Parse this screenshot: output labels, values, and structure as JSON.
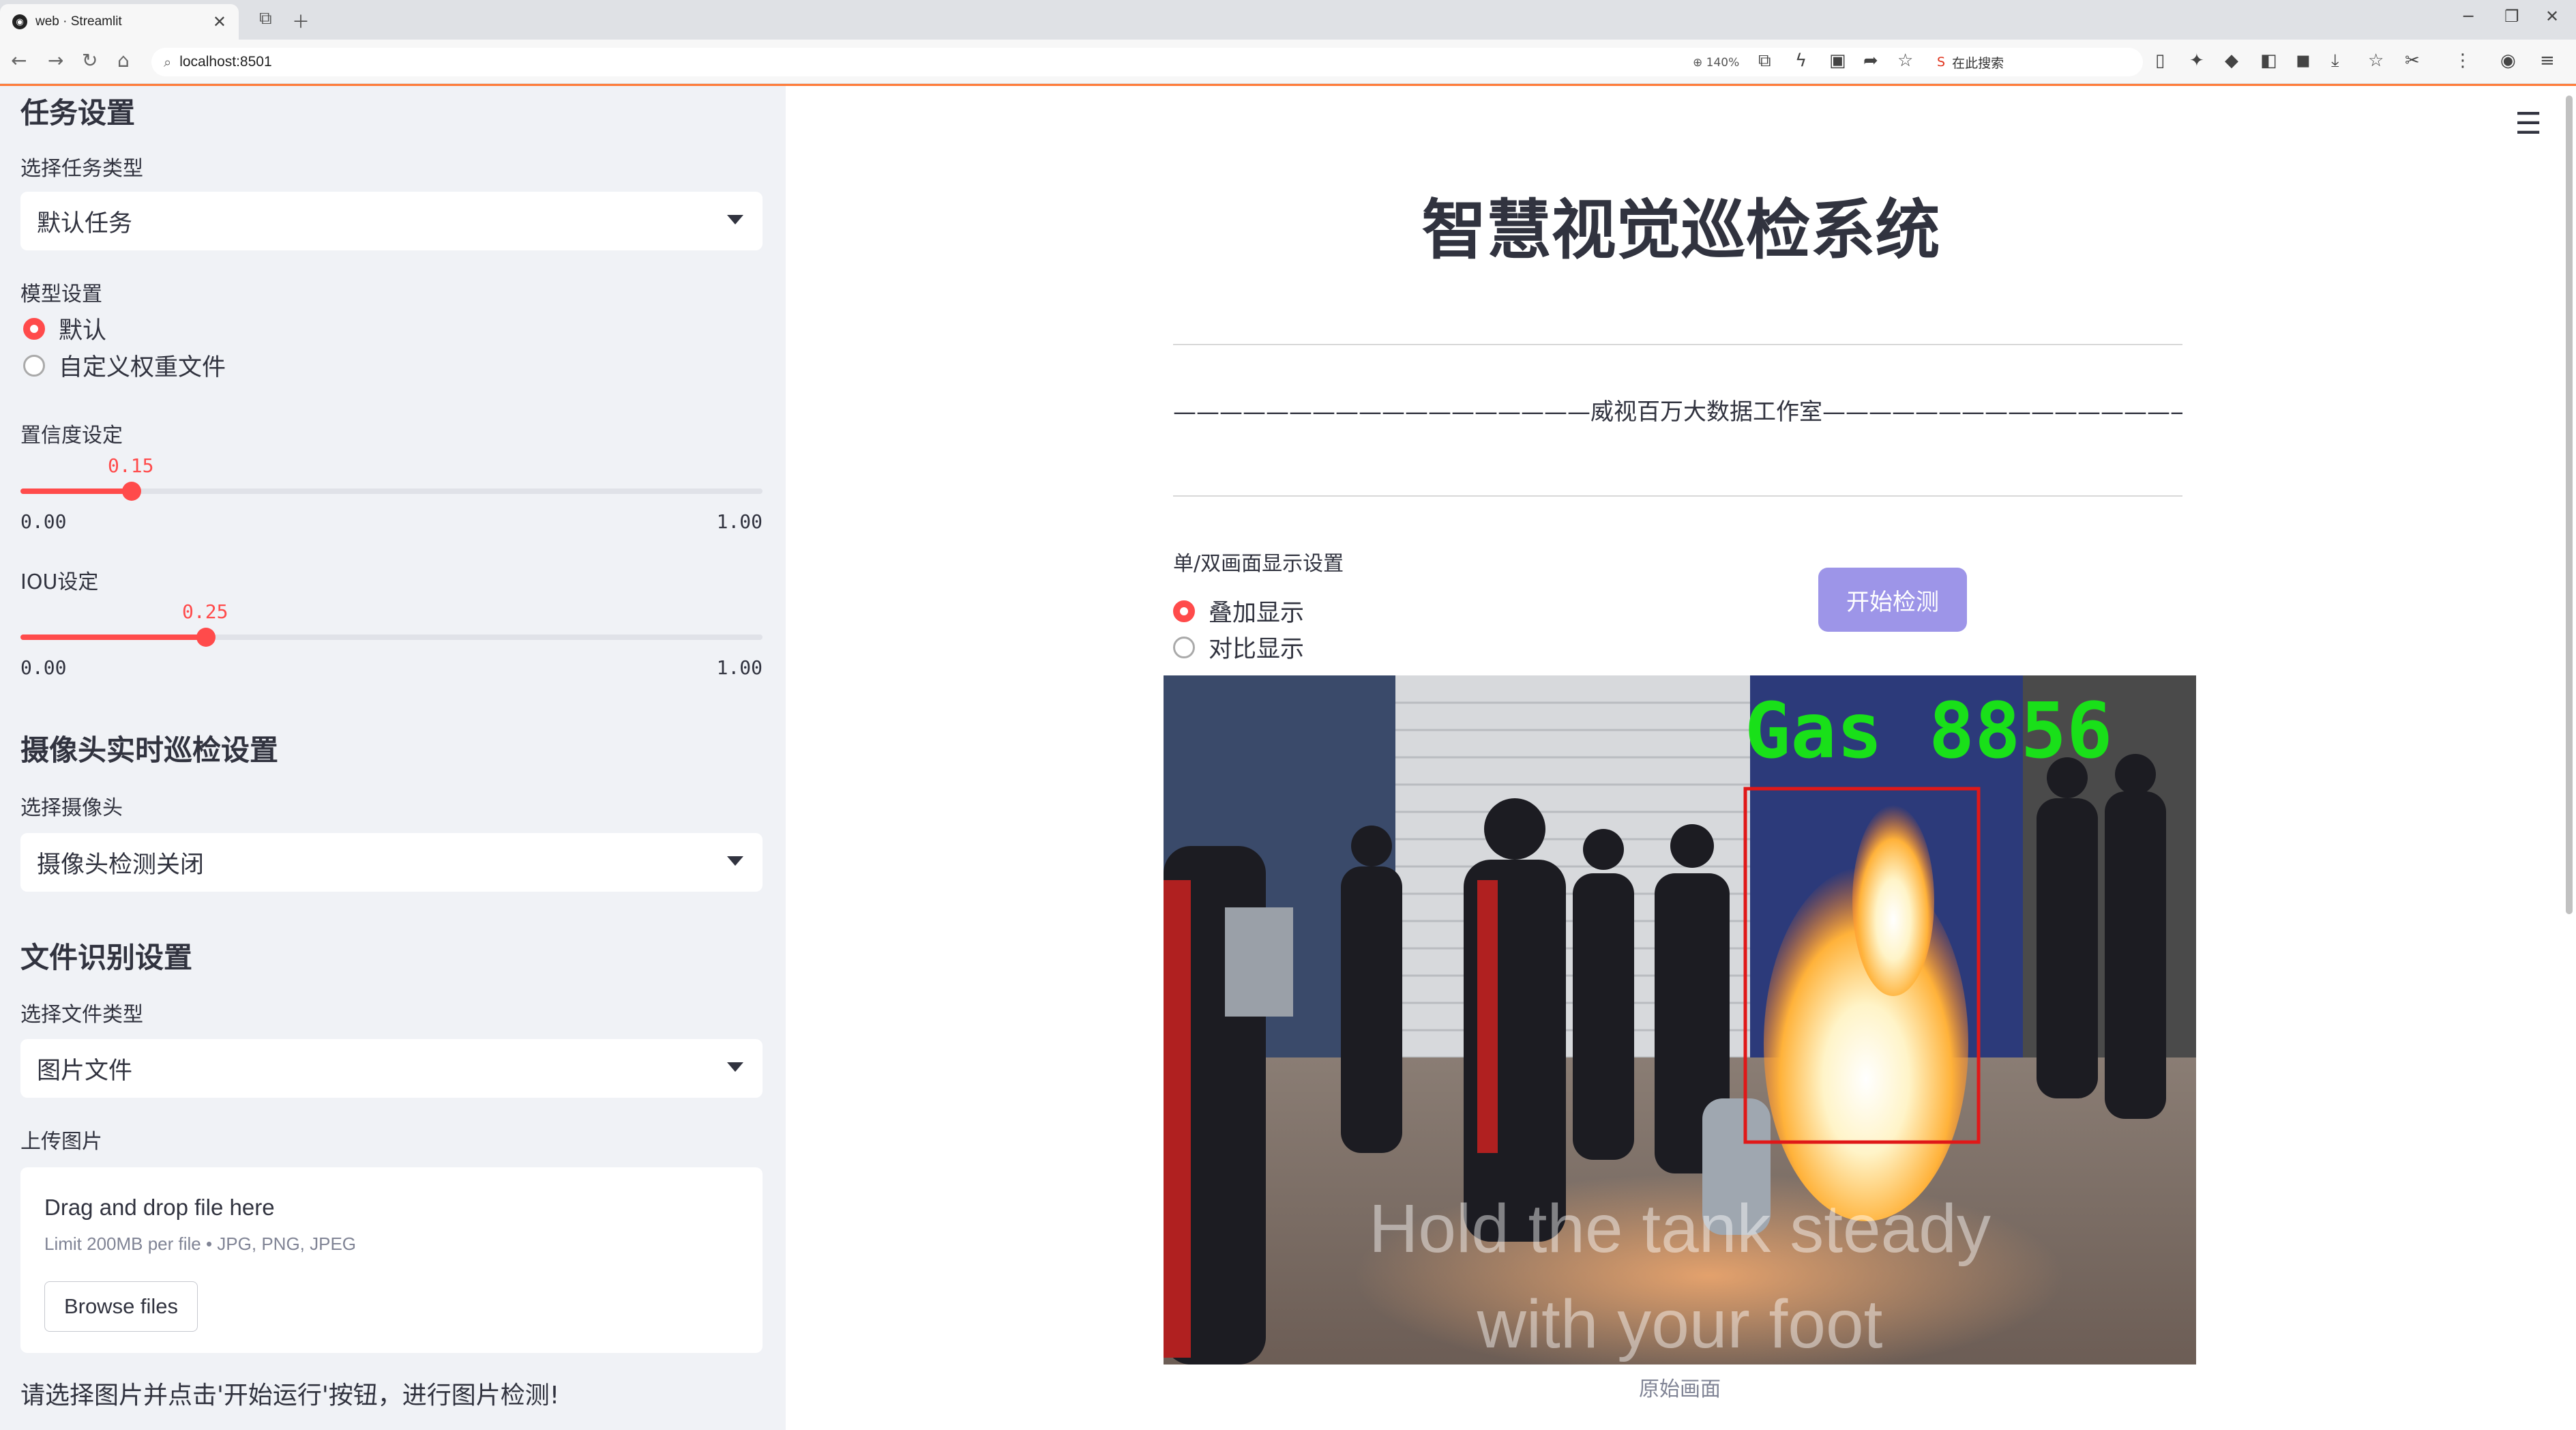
{
  "browser": {
    "tab_title": "web · Streamlit",
    "url": "localhost:8501",
    "zoom": "140%",
    "search_label": "在此搜索"
  },
  "sidebar": {
    "task_header": "任务设置",
    "task_type_label": "选择任务类型",
    "task_type_value": "默认任务",
    "model_label": "模型设置",
    "model_options": [
      "默认",
      "自定义权重文件"
    ],
    "model_selected": 0,
    "conf_label": "置信度设定",
    "conf_value": "0.15",
    "conf_fraction": 0.15,
    "iou_label": "IOU设定",
    "iou_value": "0.25",
    "iou_fraction": 0.25,
    "slider_min": "0.00",
    "slider_max": "1.00",
    "camera_header": "摄像头实时巡检设置",
    "camera_label": "选择摄像头",
    "camera_value": "摄像头检测关闭",
    "file_header": "文件识别设置",
    "file_type_label": "选择文件类型",
    "file_type_value": "图片文件",
    "upload_label": "上传图片",
    "upload_title": "Drag and drop file here",
    "upload_limit": "Limit 200MB per file • JPG, PNG, JPEG",
    "browse_label": "Browse files",
    "footer_text": "请选择图片并点击'开始运行'按钮，进行图片检测!"
  },
  "main": {
    "title": "智慧视觉巡检系统",
    "subtitle": "——————————————————威视百万大数据工作室——————————————————",
    "display_label": "单/双画面显示设置",
    "display_options": [
      "叠加显示",
      "对比显示"
    ],
    "display_selected": 0,
    "start_button": "开始检测",
    "detection_label": "Gas 8856",
    "image_subtitle_line1": "Hold the tank steady",
    "image_subtitle_line2": "with your foot",
    "image_caption": "原始画面"
  },
  "colors": {
    "accent": "#ff4b4b",
    "button": "#9d95e8",
    "sidebar_bg": "#f0f2f6",
    "box_red": "#e01818",
    "label_green": "#19e019"
  }
}
